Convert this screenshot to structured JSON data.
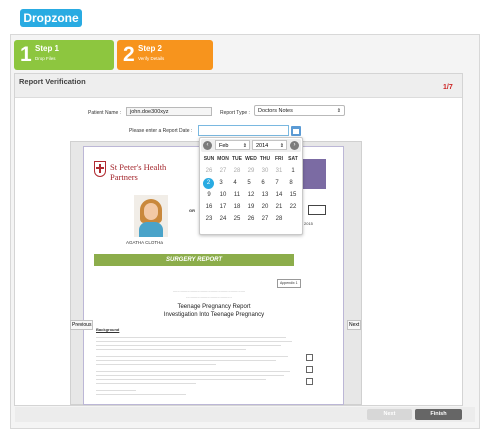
{
  "app": {
    "logo_text": "Dropzone"
  },
  "steps": [
    {
      "number": "1",
      "title": "Step 1",
      "subtitle": "Drop Files"
    },
    {
      "number": "2",
      "title": "Step 2",
      "subtitle": "Verify Details"
    }
  ],
  "panel": {
    "title": "Report Verification",
    "page_counter": "1/7"
  },
  "form": {
    "patient_label": "Patient Name :",
    "patient_value": "john.doe300xyz",
    "report_type_label": "Report Type :",
    "report_type_value": "Doctors Notes",
    "report_date_label": "Please enter a Report Date :",
    "report_date_value": ""
  },
  "calendar": {
    "prev_icon": "‹",
    "next_icon": "›",
    "month": "Feb",
    "year": "2014",
    "weekdays": [
      "SUN",
      "MON",
      "TUE",
      "WED",
      "THU",
      "FRI",
      "SAT"
    ],
    "weeks": [
      [
        "26",
        "27",
        "28",
        "29",
        "30",
        "31",
        "1"
      ],
      [
        "2",
        "3",
        "4",
        "5",
        "6",
        "7",
        "8"
      ],
      [
        "9",
        "10",
        "11",
        "12",
        "13",
        "14",
        "15"
      ],
      [
        "16",
        "17",
        "18",
        "19",
        "20",
        "21",
        "22"
      ],
      [
        "23",
        "24",
        "25",
        "26",
        "27",
        "28",
        ""
      ]
    ],
    "today": "2"
  },
  "document": {
    "org_name_line1": "St Peter's Health",
    "org_name_line2": "Partners",
    "patient_name": "AGATHA CLOTHa",
    "banner": "SURGERY REPORT",
    "title_line1": "Teenage Pregnancy Report",
    "title_line2": "Investigation Into Teenage Pregnancy",
    "section": "Background",
    "badge": "Appendix 1",
    "year_fragment": "2015"
  },
  "nav": {
    "previous": "Previous",
    "next": "Next"
  },
  "footer": {
    "next_button": "Next",
    "finish_button": "Finish"
  },
  "colors": {
    "accent": "#29abe2",
    "step1": "#8dc63f",
    "step2": "#f7941d",
    "banner": "#8cad4b",
    "header_purple": "#7b6ba3"
  }
}
